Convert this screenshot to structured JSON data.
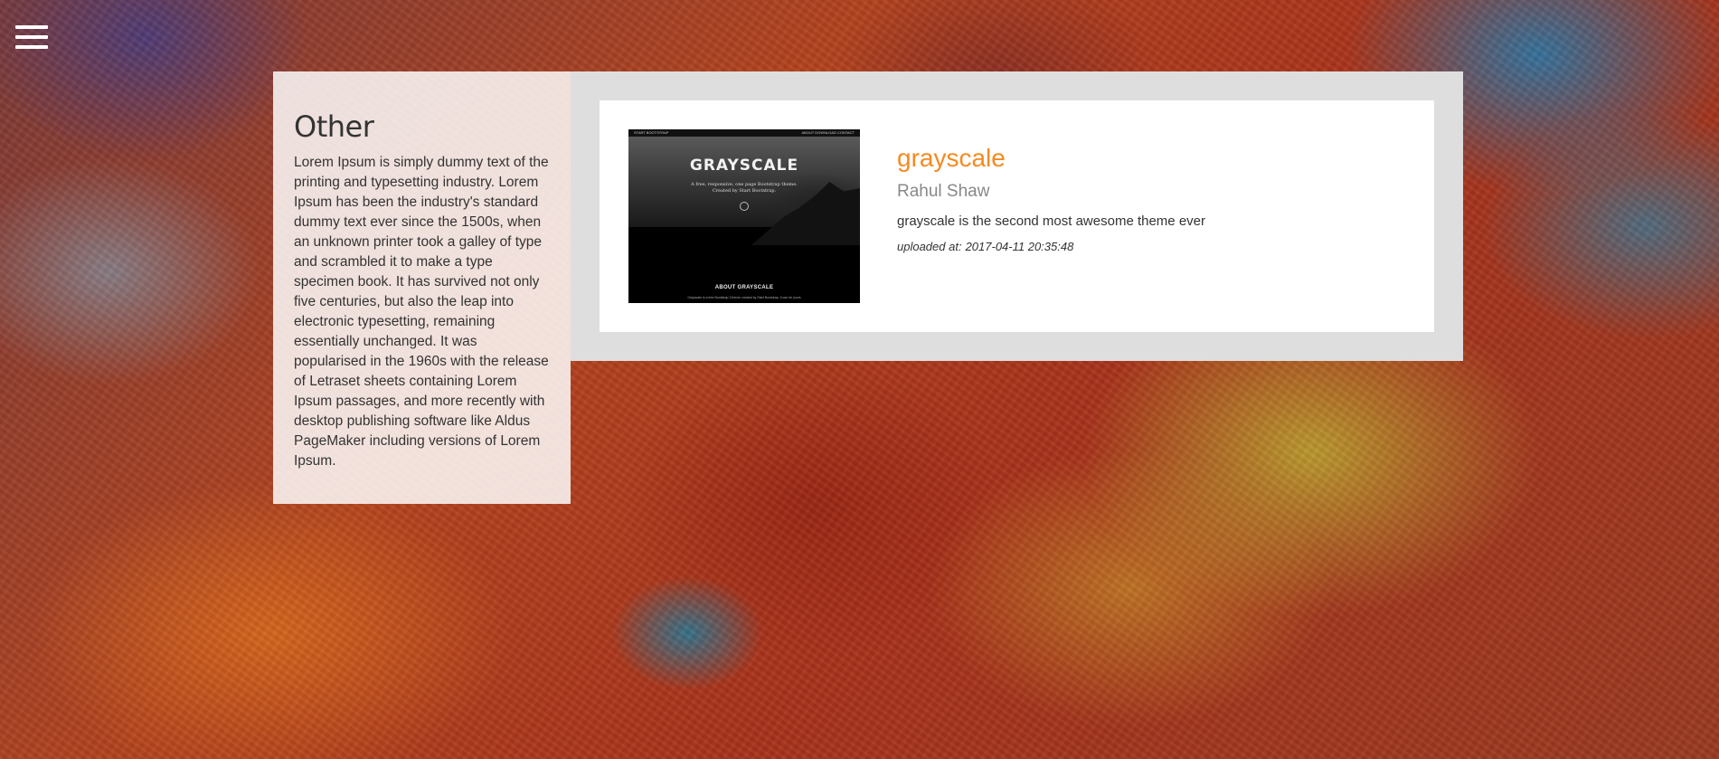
{
  "menu": {
    "icon": "hamburger-menu-icon"
  },
  "sidebar": {
    "title": "Other",
    "text": "Lorem Ipsum is simply dummy text of the printing and typesetting industry. Lorem Ipsum has been the industry's standard dummy text ever since the 1500s, when an unknown printer took a galley of type and scrambled it to make a type specimen book. It has survived not only five centuries, but also the leap into electronic typesetting, remaining essentially unchanged. It was popularised in the 1960s with the release of Letraset sheets containing Lorem Ipsum passages, and more recently with desktop publishing software like Aldus PageMaker including versions of Lorem Ipsum."
  },
  "theme_card": {
    "thumbnail": {
      "nav_brand": "START BOOTSTRAP",
      "nav_links": "ABOUT  DOWNLOAD  CONTACT",
      "heading": "GRAYSCALE",
      "subtext_line1": "A free, responsive, one page Bootstrap theme.",
      "subtext_line2": "Created by Start Bootstrap.",
      "about": "ABOUT GRAYSCALE",
      "footer": "Grayscale is a free Bootstrap 3 theme created by Start Bootstrap. It can be yours"
    },
    "name": "grayscale",
    "author": "Rahul Shaw",
    "description": "grayscale is the second most awesome theme ever",
    "uploaded_label": "uploaded at:",
    "uploaded_value": "2017-04-11 20:35:48"
  },
  "colors": {
    "accent": "#f58a1f",
    "panel_bg": "#dedede",
    "card_bg": "#ffffff"
  }
}
